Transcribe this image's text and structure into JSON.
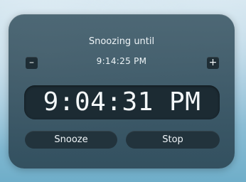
{
  "alarm": {
    "snooze_label": "Snoozing until",
    "snooze_until": "9:14:25 PM",
    "current_time": "9:04:31 PM"
  },
  "controls": {
    "decrease_label": "–",
    "increase_label": "+",
    "snooze_label": "Snooze",
    "stop_label": "Stop"
  },
  "icons": {
    "decrease": "minus-icon",
    "increase": "plus-icon"
  },
  "colors": {
    "panel": "#3a5664",
    "clock_background": "#1c2b33",
    "button_background": "#22333c",
    "text": "#eef4f7"
  }
}
